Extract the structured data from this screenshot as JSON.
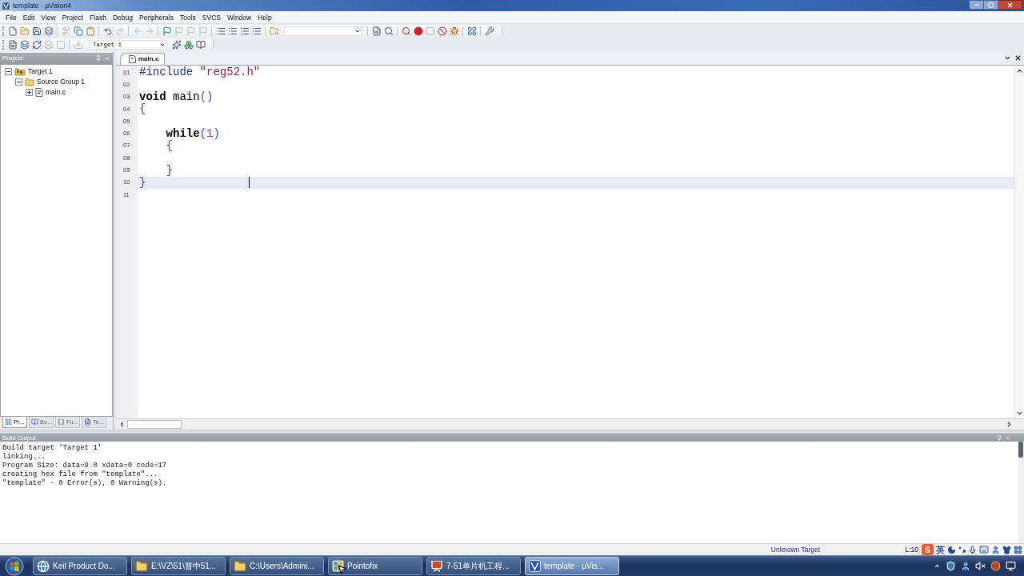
{
  "window": {
    "title": "template - µVision4"
  },
  "menu": [
    "File",
    "Edit",
    "View",
    "Project",
    "Flash",
    "Debug",
    "Peripherals",
    "Tools",
    "SVCS",
    "Window",
    "Help"
  ],
  "toolbar_1": {
    "groups": [
      {
        "buttons": [
          {
            "disabled": false
          },
          {
            "disabled": false
          },
          {
            "disabled": false
          },
          {
            "disabled": false
          }
        ]
      },
      {
        "buttons": [
          {
            "disabled": true
          },
          {
            "disabled": false
          },
          {
            "disabled": false
          }
        ]
      },
      {
        "buttons": [
          {
            "disabled": false
          },
          {
            "disabled": true
          }
        ]
      },
      {
        "buttons": [
          {
            "disabled": true
          },
          {
            "disabled": true
          }
        ]
      },
      {
        "buttons": [
          {
            "disabled": false
          },
          {
            "disabled": true
          },
          {
            "disabled": true
          },
          {
            "disabled": true
          }
        ]
      },
      {
        "buttons": [
          {
            "disabled": false
          },
          {
            "disabled": false
          },
          {
            "disabled": false
          },
          {
            "disabled": false
          }
        ]
      },
      {
        "buttons": [
          {
            "disabled": false
          }
        ]
      },
      {
        "buttons": [
          {
            "disabled": false
          },
          {
            "disabled": false
          }
        ]
      },
      {
        "buttons": [
          {
            "disabled": false
          },
          {
            "disabled": false
          },
          {
            "disabled": true
          },
          {
            "disabled": false
          },
          {
            "disabled": false
          }
        ]
      },
      {
        "buttons": [
          {
            "disabled": false
          }
        ]
      },
      {
        "buttons": [
          {
            "disabled": false
          }
        ]
      }
    ]
  },
  "toolbar_2": {
    "groups": [
      {
        "buttons": [
          {
            "disabled": false
          },
          {
            "disabled": false
          },
          {
            "disabled": false
          },
          {
            "disabled": true
          },
          {
            "disabled": true
          }
        ]
      },
      {
        "buttons": [
          {
            "disabled": true
          }
        ]
      }
    ],
    "target_select": {
      "value": "Target 1"
    },
    "target_buttons": [
      {
        "disabled": false
      },
      {
        "disabled": false
      },
      {
        "disabled": false
      }
    ]
  },
  "project_panel": {
    "title": "Project",
    "tree": [
      {
        "label": "Target 1",
        "kind": "target",
        "expanded": true,
        "children": [
          {
            "label": "Source Group 1",
            "kind": "group",
            "expanded": true,
            "children": [
              {
                "label": "main.c",
                "kind": "file",
                "expanded": false
              }
            ]
          }
        ]
      }
    ],
    "tabs": [
      {
        "label": "Pr...",
        "selected": true
      },
      {
        "label": "Bo...",
        "selected": false
      },
      {
        "label": "Fu...",
        "selected": false
      },
      {
        "label": "Te...",
        "selected": false
      }
    ]
  },
  "editor": {
    "tabs": [
      {
        "label": "main.c",
        "selected": true
      }
    ],
    "lines": [
      {
        "number": "01",
        "current": false,
        "tokens": [
          {
            "text": "#include",
            "kind": "directive"
          },
          {
            "text": " \"reg52.h\"",
            "kind": "string"
          }
        ]
      },
      {
        "number": "02",
        "current": false
      },
      {
        "number": "03",
        "current": false,
        "tokens": [
          {
            "text": "void",
            "kind": "keyword"
          },
          {
            "text": " main",
            "kind": "identifier"
          },
          {
            "text": "()",
            "kind": "punctuation"
          }
        ]
      },
      {
        "number": "04",
        "current": false,
        "tokens": [
          {
            "text": "{",
            "kind": "punctuation"
          }
        ]
      },
      {
        "number": "05",
        "current": false
      },
      {
        "number": "06",
        "current": false,
        "tokens": [
          {
            "text": "    while",
            "kind": "keyword"
          },
          {
            "text": "(",
            "kind": "punctuation"
          },
          {
            "text": "1",
            "kind": "number"
          },
          {
            "text": ")",
            "kind": "punctuation"
          }
        ]
      },
      {
        "number": "07",
        "current": false,
        "tokens": [
          {
            "text": "    {",
            "kind": "punctuation"
          }
        ]
      },
      {
        "number": "08",
        "current": false
      },
      {
        "number": "09",
        "current": false,
        "tokens": [
          {
            "text": "    }",
            "kind": "punctuation"
          }
        ]
      },
      {
        "number": "10",
        "current": true,
        "tokens": [
          {
            "text": "}",
            "kind": "punctuation"
          }
        ]
      },
      {
        "number": "11",
        "current": false
      }
    ]
  },
  "build_output": {
    "title": "Build Output",
    "lines": [
      "Build target 'Target 1'",
      "linking...",
      "Program Size: data=9.0 xdata=0 code=17",
      "creating hex file from \"template\"...",
      "\"template\" - 0 Error(s), 0 Warning(s)."
    ]
  },
  "status_bar": {
    "target": "Unknown Target",
    "position": "L:10"
  },
  "ime_bar": {
    "logo": "S",
    "language": "英"
  },
  "taskbar": {
    "items": [
      {
        "label": "Keil Product Do...",
        "selected": false
      },
      {
        "label": "E:\\VZ\\51\\普中51...",
        "selected": false
      },
      {
        "label": "C:\\Users\\Admini...",
        "selected": false
      },
      {
        "label": "Pointofix",
        "selected": false
      },
      {
        "label": "7-51单片机工程...",
        "selected": false
      },
      {
        "label": "template - µVis...",
        "selected": true
      }
    ]
  }
}
